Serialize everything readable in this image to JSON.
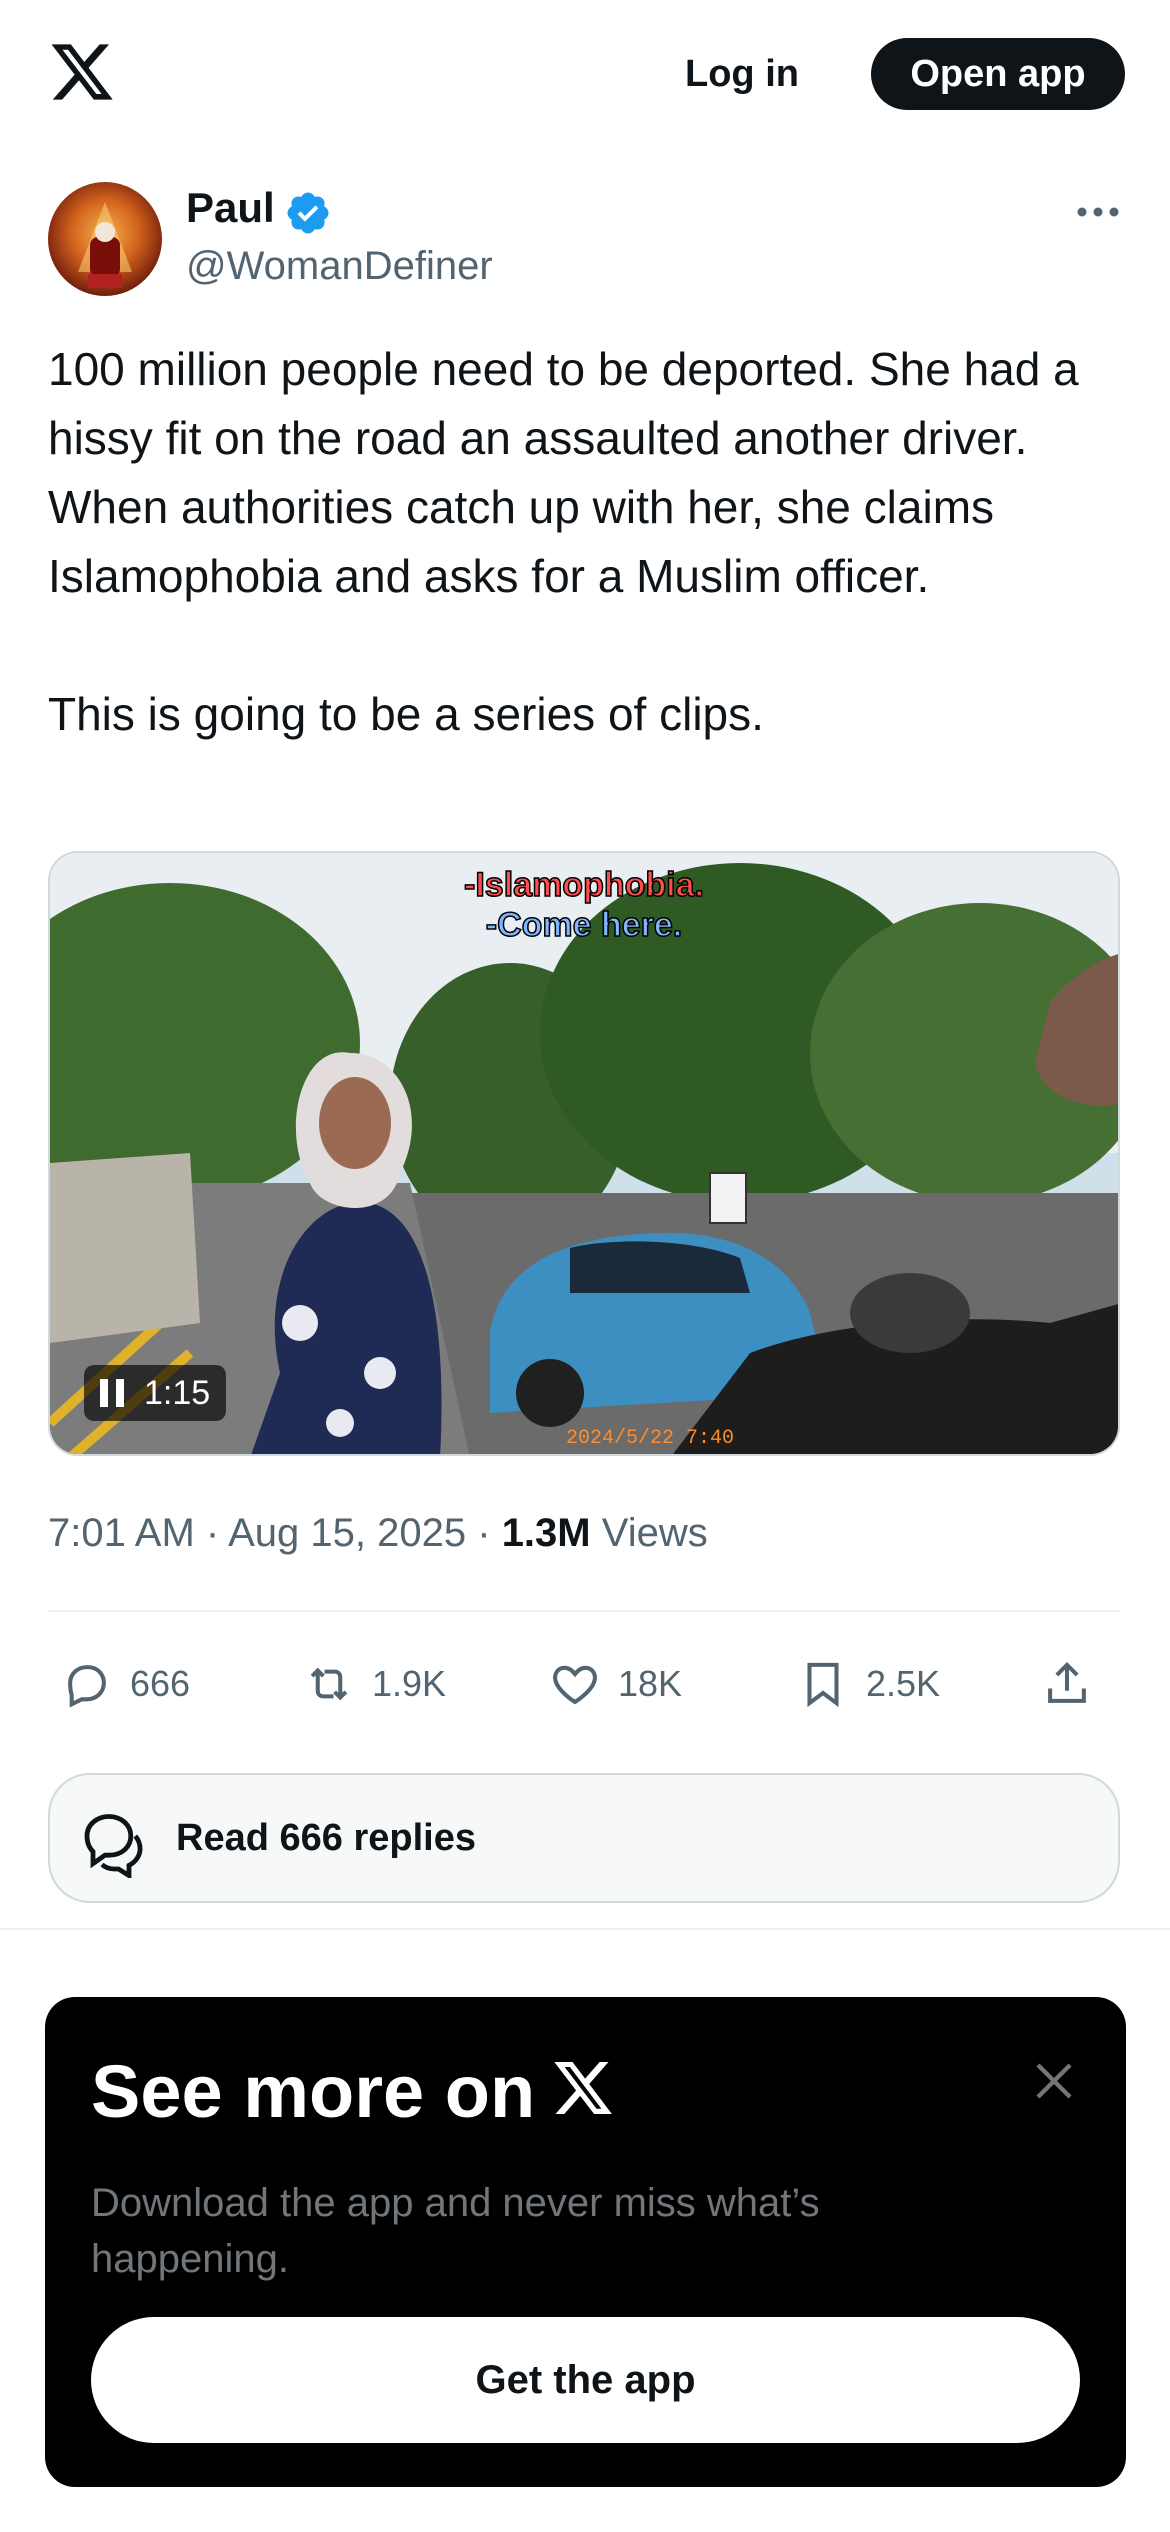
{
  "topbar": {
    "logo_icon": "x-logo-icon",
    "login_label": "Log in",
    "open_app_label": "Open app"
  },
  "post": {
    "author_name": "Paul",
    "author_handle": "@WomanDefiner",
    "verified_icon": "verified-badge-icon",
    "more_icon": "more-options-icon",
    "text_paragraph_1": "100 million people need to be deported. She had a hissy fit on the road an assaulted another driver. When authorities catch up with her, she claims Islamophobia and asks for a Muslim officer.",
    "text_paragraph_2": "This is going to be a series of clips.",
    "video": {
      "caption_line_1": "-Islamophobia.",
      "caption_line_2": "-Come here.",
      "duration": "1:15",
      "date_stamp": "2024/5/22  7:40"
    },
    "time": "7:01 AM",
    "date": "Aug 15, 2025",
    "views_count": "1.3M",
    "views_label": "Views"
  },
  "actions": {
    "replies": {
      "icon": "reply-icon",
      "count": "666"
    },
    "reposts": {
      "icon": "repost-icon",
      "count": "1.9K"
    },
    "likes": {
      "icon": "like-icon",
      "count": "18K"
    },
    "bookmarks": {
      "icon": "bookmark-icon",
      "count": "2.5K"
    },
    "share": {
      "icon": "share-icon"
    }
  },
  "read_replies_label": "Read 666 replies",
  "promo": {
    "title": "See more on",
    "subtitle": "Download the app and never miss what’s happening.",
    "button_label": "Get the app"
  },
  "colors": {
    "text_primary": "#0f1419",
    "text_secondary": "#536471",
    "verified_blue": "#1d9bf0",
    "border": "#cfd9de"
  }
}
